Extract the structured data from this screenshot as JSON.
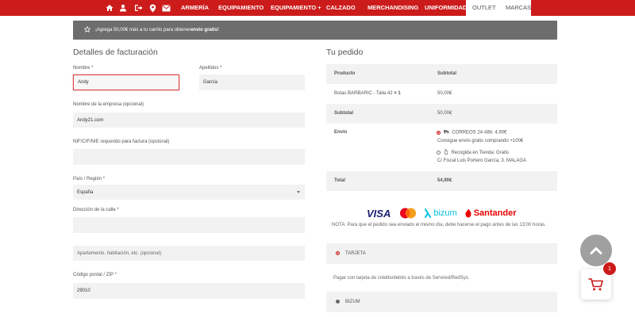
{
  "nav": {
    "icons": [
      "home-icon",
      "user-icon",
      "logout-icon",
      "location-icon",
      "mail-icon"
    ],
    "links": [
      "ARMERÍA",
      "EQUIPAMIENTO",
      "EQUIPAMIENTO +",
      "CALZADO",
      "MERCHANDISING",
      "UNIFORMIDAD"
    ],
    "boxes": [
      "OUTLET",
      "MARCAS"
    ]
  },
  "notice": {
    "text": "¡Agrega 50,00€ más a tu carrito para obtener ",
    "bold": "envío gratis!"
  },
  "billing": {
    "title": "Detalles de facturación",
    "nombre_label": "Nombre *",
    "nombre_value": "Andy",
    "apellidos_label": "Apellidos *",
    "apellidos_value": "García",
    "empresa_label": "Nombre de la empresa (opcional)",
    "empresa_value": "Andy21.com",
    "nif_label": "NIF/CIF/NIE requerido para factura (opcional)",
    "nif_value": "",
    "pais_label": "País / Región *",
    "pais_value": "España",
    "calle_label": "Dirección de la calle *",
    "calle_value": "",
    "apartamento_placeholder": "Apartamento, habitación, etc. (opcional)",
    "cp_label": "Código postal / ZIP *",
    "cp_value": "29010"
  },
  "order": {
    "title": "Tu pedido",
    "col_producto": "Producto",
    "col_subtotal": "Subtotal",
    "item_name": "Botas BARBARIC - Talla 42",
    "item_qty": "× 1",
    "item_price": "50,00€",
    "subtotal_label": "Subtotal",
    "subtotal_value": "50,00€",
    "envio_label": "Envío",
    "envio_opt1": "CORREOS 24-48h: 4,90€",
    "envio_opt1_note": "Consigue envío gratis comprando +100€",
    "envio_opt2": "Recogida en Tienda: Gratis",
    "envio_opt2_note": "C/ Fiscal Luis Portero García, 3. MALAGA",
    "total_label": "Total",
    "total_value": "54,90€"
  },
  "payment": {
    "logos": [
      "VISA",
      "mastercard",
      "bizum",
      "Santander"
    ],
    "note": "NOTA: Para que el pedido sea enviado el mismo día, debe hacerse el pago antes de las 13:00 horas.",
    "tarjeta_label": "TARJETA",
    "tarjeta_desc": "Pagar con tarjeta de crédito/debito a través de Servired/RedSys.",
    "bizum_label": "BIZUM"
  },
  "cart": {
    "count": "1"
  },
  "colors": {
    "brand_red": "#cc1b1b",
    "notice_gray": "#6d6d6d"
  }
}
